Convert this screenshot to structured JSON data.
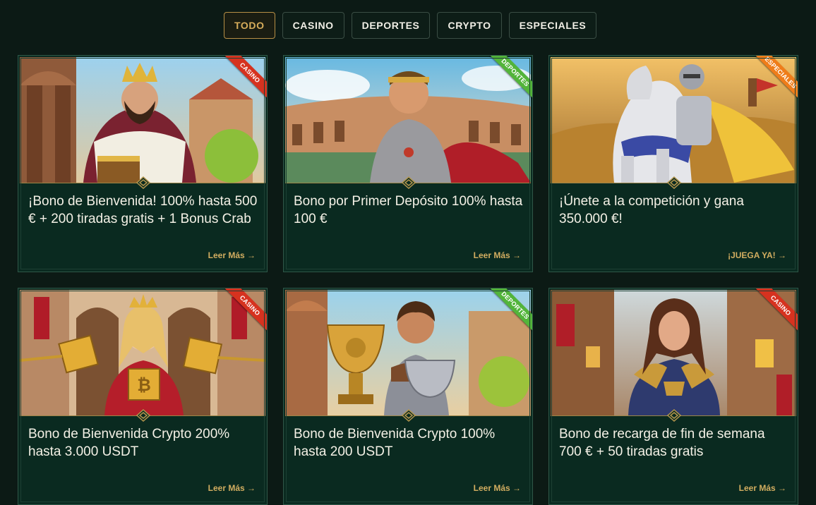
{
  "tabs": [
    {
      "label": "TODO",
      "active": true
    },
    {
      "label": "CASINO",
      "active": false
    },
    {
      "label": "DEPORTES",
      "active": false
    },
    {
      "label": "CRYPTO",
      "active": false
    },
    {
      "label": "ESPECIALES",
      "active": false
    }
  ],
  "colors": {
    "background": "#0c1a15",
    "card": "#0a2a20",
    "gold": "#d2ad60",
    "casino": "#d6321f",
    "deportes": "#52b43a",
    "especiales": "#ef7d1a"
  },
  "cards": [
    {
      "title": "¡Bono de Bienvenida! 100% hasta 500 € + 200 tiradas gratis + 1 Bonus Crab",
      "cta": "Leer Más →",
      "ribbon": "CASINO",
      "image": "king-with-treasure-chest"
    },
    {
      "title": "Bono por Primer Depósito 100% hasta 100 €",
      "cta": "Leer Más →",
      "ribbon": "DEPORTES",
      "image": "gladiator-in-arena"
    },
    {
      "title": "¡Únete a la competición y gana 350.000 €!",
      "cta": "¡JUEGA YA! →",
      "ribbon": "ESPECIALES",
      "image": "knight-on-horse"
    },
    {
      "title": "Bono de Bienvenida Crypto 200% hasta 3.000 USDT",
      "cta": "Leer Más →",
      "ribbon": "CASINO",
      "image": "queen-with-crypto-cubes"
    },
    {
      "title": "Bono de Bienvenida Crypto 100% hasta 200 USDT",
      "cta": "Leer Más →",
      "ribbon": "DEPORTES",
      "image": "warrior-with-trophy"
    },
    {
      "title": "Bono de recarga de fin de semana 700 € + 50 tiradas gratis",
      "cta": "Leer Más →",
      "ribbon": "CASINO",
      "image": "woman-in-medieval-street"
    }
  ]
}
